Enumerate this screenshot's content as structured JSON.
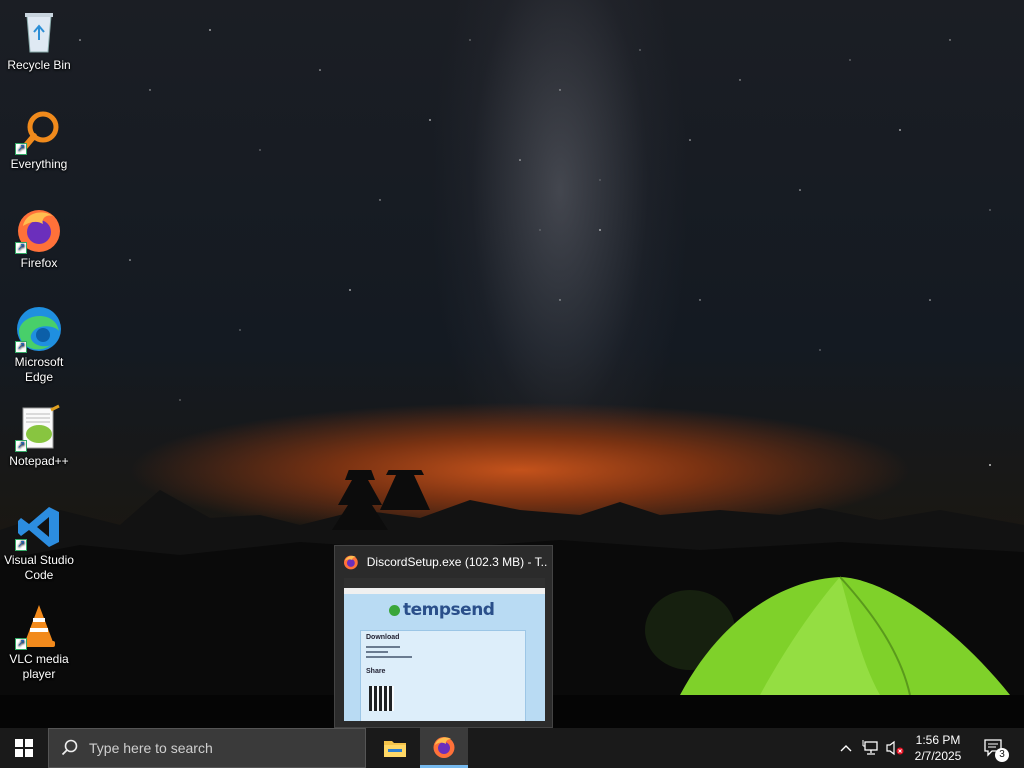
{
  "desktop_icons": [
    {
      "label": "Recycle Bin",
      "icon": "recycle-bin-icon"
    },
    {
      "label": "Everything",
      "icon": "everything-search-icon"
    },
    {
      "label": "Firefox",
      "icon": "firefox-icon"
    },
    {
      "label": "Microsoft Edge",
      "icon": "edge-icon"
    },
    {
      "label": "Notepad++",
      "icon": "notepadpp-icon"
    },
    {
      "label": "Visual Studio Code",
      "icon": "vscode-icon"
    },
    {
      "label": "VLC media player",
      "icon": "vlc-icon"
    }
  ],
  "preview": {
    "title": "DiscordSetup.exe (102.3 MB) - T...",
    "site_logo": "tempsend",
    "card_heading": "Download",
    "card_subheading": "Share"
  },
  "taskbar": {
    "search_placeholder": "Type here to search",
    "apps": [
      {
        "name": "File Explorer",
        "icon": "file-explorer-icon",
        "active": false
      },
      {
        "name": "Firefox",
        "icon": "firefox-icon",
        "active": true
      }
    ],
    "clock": {
      "time": "1:56 PM",
      "date": "2/7/2025"
    },
    "notification_count": "3"
  },
  "colors": {
    "taskbar": "#1a1a1a",
    "active_indicator": "#76b9ed",
    "tent": "#7fd12a"
  }
}
